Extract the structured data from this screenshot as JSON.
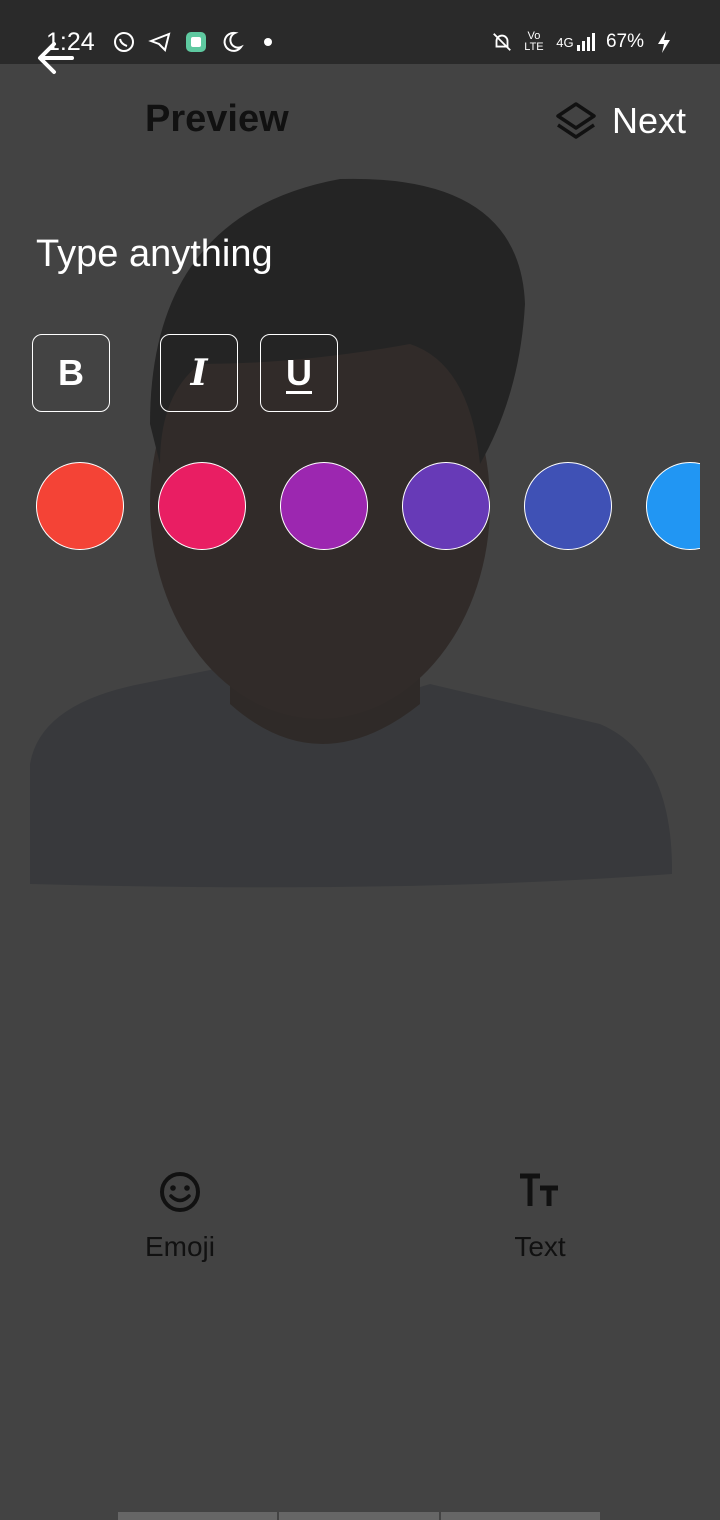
{
  "status": {
    "time": "1:24",
    "network": "4G",
    "volte": "Vo LTE",
    "battery": "67%"
  },
  "header": {
    "title": "Preview",
    "next_label": "Next"
  },
  "editor": {
    "placeholder": "Type anything",
    "format_buttons": {
      "bold": "B",
      "italic": "I",
      "underline": "U"
    },
    "colors": [
      "#F44336",
      "#E91E63",
      "#9C27B0",
      "#673AB7",
      "#3F51B5",
      "#2196F3"
    ]
  },
  "tools": {
    "emoji_label": "Emoji",
    "text_label": "Text"
  },
  "icons": {
    "back": "arrow-left-icon",
    "layers": "layers-icon",
    "emoji": "smiley-icon",
    "text": "text-size-icon"
  }
}
